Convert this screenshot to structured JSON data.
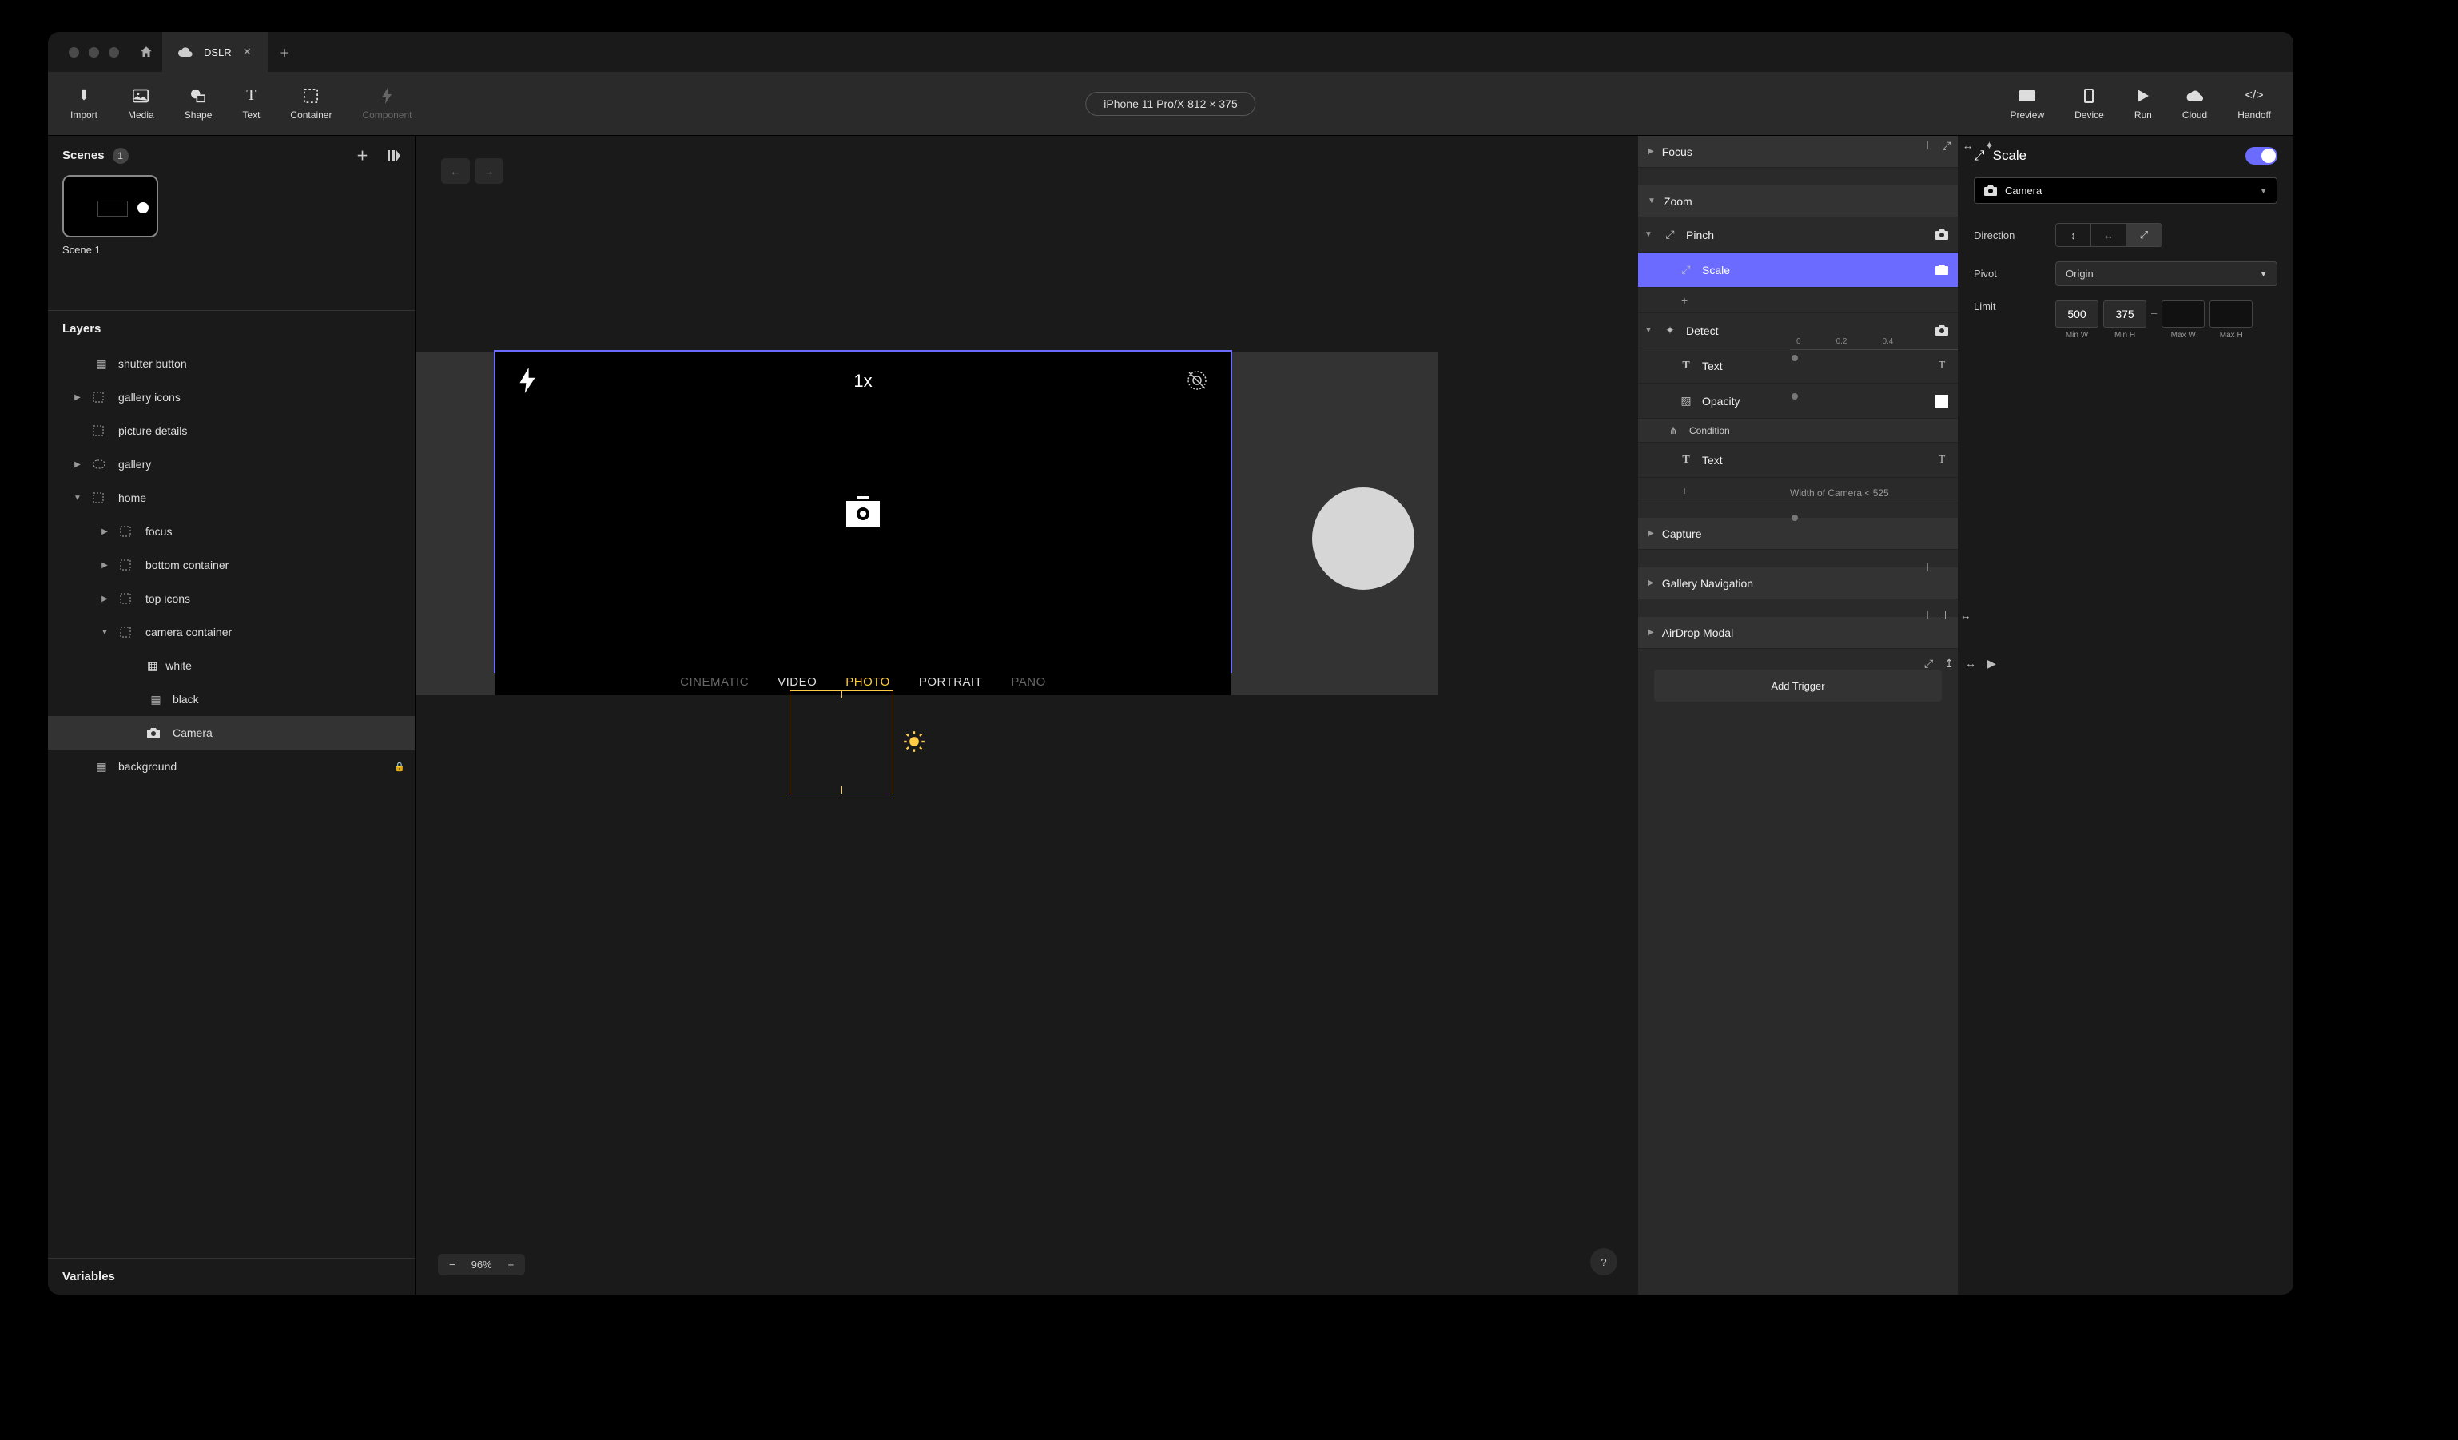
{
  "titlebar": {
    "tab_name": "DSLR"
  },
  "toolbar": {
    "import": "Import",
    "media": "Media",
    "shape": "Shape",
    "text": "Text",
    "container": "Container",
    "component": "Component",
    "preview": "Preview",
    "device": "Device",
    "run": "Run",
    "cloud": "Cloud",
    "handoff": "Handoff",
    "device_label": "iPhone 11 Pro/X  812 × 375"
  },
  "scenes": {
    "header": "Scenes",
    "count": "1",
    "scene1": "Scene 1"
  },
  "layers": {
    "header": "Layers",
    "items": {
      "shutter": "shutter button",
      "gicons": "gallery icons",
      "pdetails": "picture details",
      "gallery": "gallery",
      "home": "home",
      "focus": "focus",
      "bottom": "bottom container",
      "topicons": "top icons",
      "camcont": "camera container",
      "white": "white",
      "black": "black",
      "camera": "Camera",
      "background": "background"
    }
  },
  "variables": "Variables",
  "canvas": {
    "zoom_txt": "1x",
    "modes": {
      "cine": "CINEMATIC",
      "video": "VIDEO",
      "photo": "PHOTO",
      "portrait": "PORTRAIT",
      "pano": "PANO"
    },
    "zoom_pct": "96%"
  },
  "triggers": {
    "focus": "Focus",
    "zoom": "Zoom",
    "pinch": "Pinch",
    "scale": "Scale",
    "detect": "Detect",
    "text": "Text",
    "opacity": "Opacity",
    "condition": "Condition",
    "capture": "Capture",
    "gnav": "Gallery Navigation",
    "airdrop": "AirDrop Modal",
    "add": "Add Trigger",
    "plus": "+",
    "ruler": {
      "t0": "0",
      "t1": "0.2",
      "t2": "0.4"
    }
  },
  "inspector": {
    "title": "Scale",
    "target": "Camera",
    "direction": "Direction",
    "pivot_lab": "Pivot",
    "pivot_val": "Origin",
    "limit": "Limit",
    "minw": "500",
    "minh": "375",
    "labs": {
      "minw": "Min W",
      "minh": "Min H",
      "maxw": "Max W",
      "maxh": "Max H"
    },
    "condition": "Width of Camera < 525"
  }
}
